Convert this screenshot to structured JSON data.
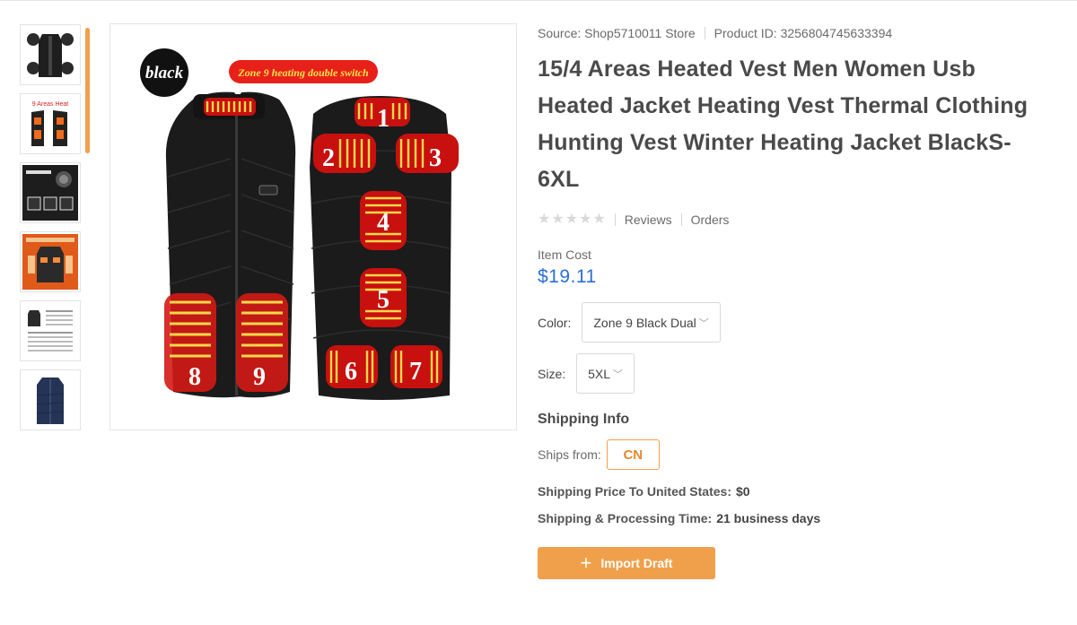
{
  "product": {
    "source": "Source: Shop5710011 Store",
    "product_id": "Product ID: 3256804745633394",
    "title": "15/4 Areas Heated Vest Men Women Usb Heated Jacket Heating Vest Thermal Clothing Hunting Vest Winter Heating Jacket BlackS-6XL",
    "reviews_label": "Reviews",
    "orders_label": "Orders",
    "rating_stars": 0,
    "item_cost_label": "Item Cost",
    "item_cost_value": "$19.11"
  },
  "options": {
    "color_label": "Color:",
    "color_value": "Zone 9 Black Dual",
    "size_label": "Size:",
    "size_value": "5XL"
  },
  "shipping": {
    "title": "Shipping Info",
    "ships_from_label": "Ships from:",
    "ships_from_value": "CN",
    "price_label": "Shipping Price To United States:",
    "price_value": "$0",
    "time_label": "Shipping & Processing Time:",
    "time_value": "21 business days"
  },
  "actions": {
    "import_label": "Import Draft"
  },
  "main_image": {
    "badge_text": "black",
    "banner_text": "Zone 9 heating double switch",
    "zones": [
      "1",
      "2",
      "3",
      "4",
      "5",
      "6",
      "7",
      "8",
      "9"
    ]
  },
  "thumbnails": [
    {
      "name": "thumb-vest-black-front"
    },
    {
      "name": "thumb-9-areas-heat",
      "caption": "9 Areas Heat"
    },
    {
      "name": "thumb-controller-info"
    },
    {
      "name": "thumb-orange-vest"
    },
    {
      "name": "thumb-size-chart"
    },
    {
      "name": "thumb-navy-vest"
    }
  ],
  "colors": {
    "accent": "#f0a04b",
    "price_blue": "#2b6fd6",
    "heat_red": "#d7261e",
    "heat_yellow": "#ffd84a"
  }
}
